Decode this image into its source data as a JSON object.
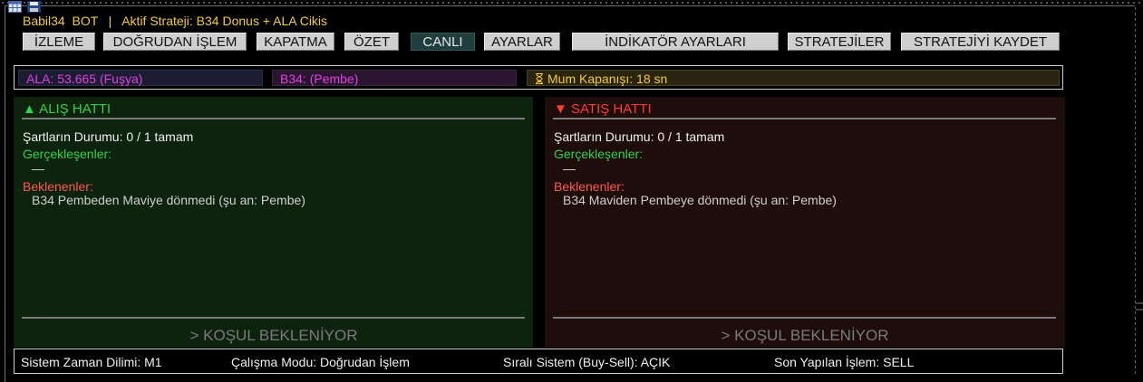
{
  "window": {
    "title": "Babil34  BOT   |   Aktif Strateji: B34 Donus + ALA Cikis"
  },
  "tabs": [
    {
      "label": "İZLEME",
      "active": false
    },
    {
      "label": "DOĞRUDAN İŞLEM",
      "active": false
    },
    {
      "label": "KAPATMA",
      "active": false
    },
    {
      "label": "ÖZET",
      "active": false
    },
    {
      "label": "CANLI",
      "active": true
    },
    {
      "label": "AYARLAR",
      "active": false
    },
    {
      "label": "İNDİKATÖR AYARLARI",
      "active": false
    },
    {
      "label": "STRATEJİLER",
      "active": false
    },
    {
      "label": "STRATEJİYİ KAYDET",
      "active": false
    }
  ],
  "status": {
    "ala": "ALA: 53.665 (Fuşya)",
    "b34": "B34: (Pembe)",
    "mum": "Mum Kapanışı: 18 sn",
    "mum_icon": "hourglass-icon"
  },
  "buy_panel": {
    "header": "▲ ALIŞ HATTI",
    "conditions": "Şartların Durumu: 0 / 1 tamam",
    "realized_label": "Gerçekleşenler:",
    "realized_value": "—",
    "pending_label": "Beklenenler:",
    "pending_value": "B34 Pembeden Maviye dönmedi (şu an: Pembe)",
    "state": "> KOŞUL BEKLENİYOR"
  },
  "sell_panel": {
    "header": "▼ SATIŞ HATTI",
    "conditions": "Şartların Durumu: 0 / 1 tamam",
    "realized_label": "Gerçekleşenler:",
    "realized_value": "—",
    "pending_label": "Beklenenler:",
    "pending_value": "B34 Maviden Pembeye dönmedi (şu an: Pembe)",
    "state": "> KOŞUL BEKLENİYOR"
  },
  "footer": {
    "timeframe": "Sistem Zaman Dilimi: M1",
    "mode": "Çalışma Modu: Doğrudan İşlem",
    "sequential": "Sıralı Sistem (Buy-Sell): AÇIK",
    "last_trade": "Son Yapılan İşlem: SELL"
  },
  "colors": {
    "title": "#f2cc3a",
    "buy": "#33d14a",
    "sell": "#ff3b2f",
    "magenta": "#e040e0",
    "active_tab": "#1f3f3f"
  }
}
